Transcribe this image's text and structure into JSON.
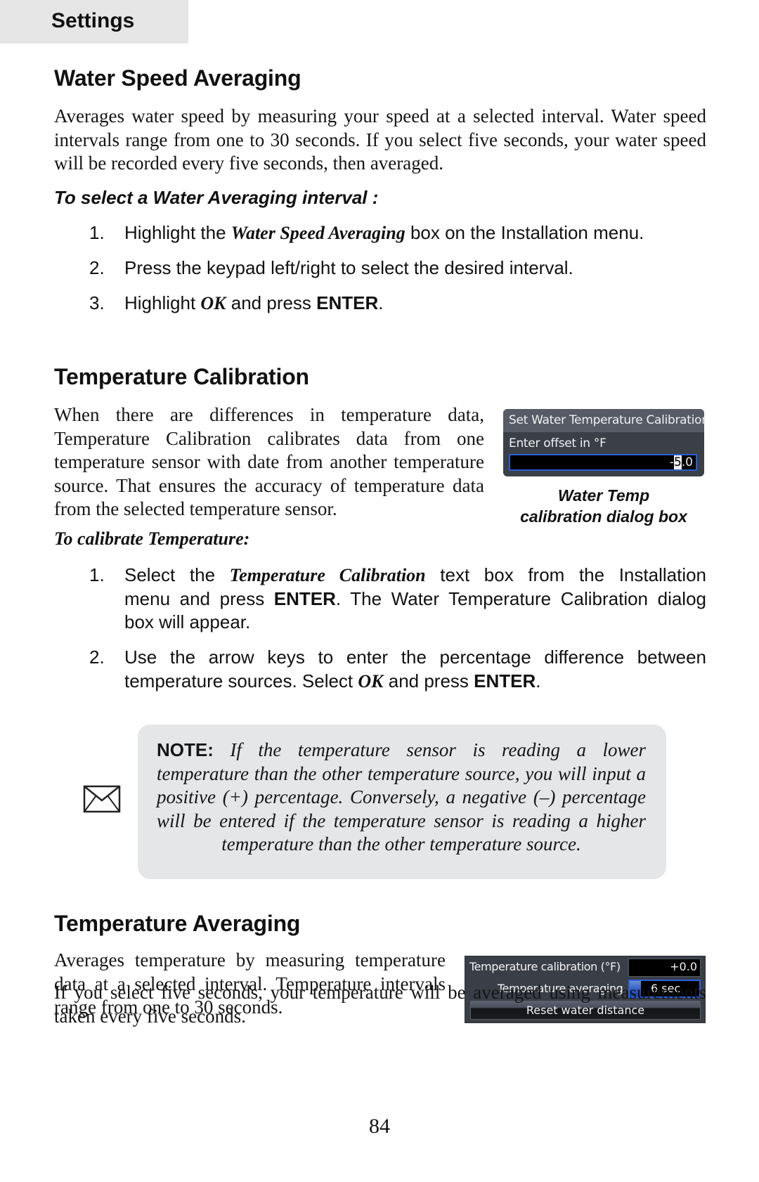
{
  "header": {
    "section": "Settings"
  },
  "water_speed_averaging": {
    "title": "Water Speed Averaging",
    "description_lines": [
      "Averages water speed by measuring your speed at a selected interval. Water speed",
      "intervals range from one to 30 seconds. If you select five seconds, your water speed",
      "will be recorded every five seconds, then averaged."
    ],
    "procedure_heading": "To select a Water Averaging interval :",
    "steps": [
      {
        "num": "1.",
        "pre": "Highlight the ",
        "em": "Water Speed Averaging",
        "post": " box on the Installation menu."
      },
      {
        "num": "2.",
        "text": "Press the keypad left/right to select the desired interval."
      },
      {
        "num": "3.",
        "pre": "Highlight ",
        "em": "OK",
        "mid": " and press ",
        "strong": "ENTER",
        "post": "."
      }
    ]
  },
  "temperature_calibration": {
    "title": "Temperature Calibration",
    "description_lines": [
      "When there are differences in temperature data,",
      "Temperature Calibration calibrates data from one",
      "temperature sensor with date from another temperature",
      "source. That ensures the accuracy of temperature data",
      "from the selected temperature sensor."
    ],
    "procedure_heading": "To calibrate Temperature:",
    "dialog": {
      "title": "Set Water Temperature Calibration",
      "label": "Enter offset in °F",
      "value_prefix": "-",
      "value_cursor": "5",
      "value_suffix": ".0",
      "accent_color": "#2a5fd6"
    },
    "caption_lines": [
      "Water Temp",
      "calibration dialog box"
    ],
    "steps": [
      {
        "num": "1.",
        "line1_pre": "Select the ",
        "line1_em": "Temperature Calibration",
        "line1_post": " text box from the Installation",
        "line2_pre": "menu and press ",
        "line2_strong": "ENTER",
        "line2_post": ". The Water Temperature Calibration dialog",
        "line3": "box will appear."
      },
      {
        "num": "2.",
        "line1": "Use the arrow keys to enter the percentage difference between",
        "line2_pre": "temperature sources. Select ",
        "line2_em": "OK",
        "line2_mid": " and press ",
        "line2_strong": "ENTER",
        "line2_post": "."
      }
    ],
    "note": {
      "label": "NOTE:",
      "lines": [
        " If the temperature sensor is reading a lower",
        "temperature than the other temperature source, you will input a",
        "positive (+) percentage. Conversely, a negative (–) percentage",
        "will be entered if the temperature sensor is reading a higher",
        "temperature than the other temperature source."
      ],
      "icon": "envelope-icon"
    }
  },
  "temperature_averaging": {
    "title": "Temperature Averaging",
    "description_lines": [
      "Averages temperature by measuring temperature",
      "data at a selected interval. Temperature intervals",
      "range from one to 30 seconds."
    ],
    "followup_lines": [
      "If you select five seconds, your temperature will be averaged using measurements",
      "taken every five seconds."
    ],
    "panel": {
      "calibration_label": "Temperature calibration (°F)",
      "calibration_value": "+0.0",
      "averaging_label": "Temperature averaging",
      "averaging_value": "6 sec",
      "reset_button": "Reset water distance"
    }
  },
  "footer": {
    "page_number": "84"
  }
}
